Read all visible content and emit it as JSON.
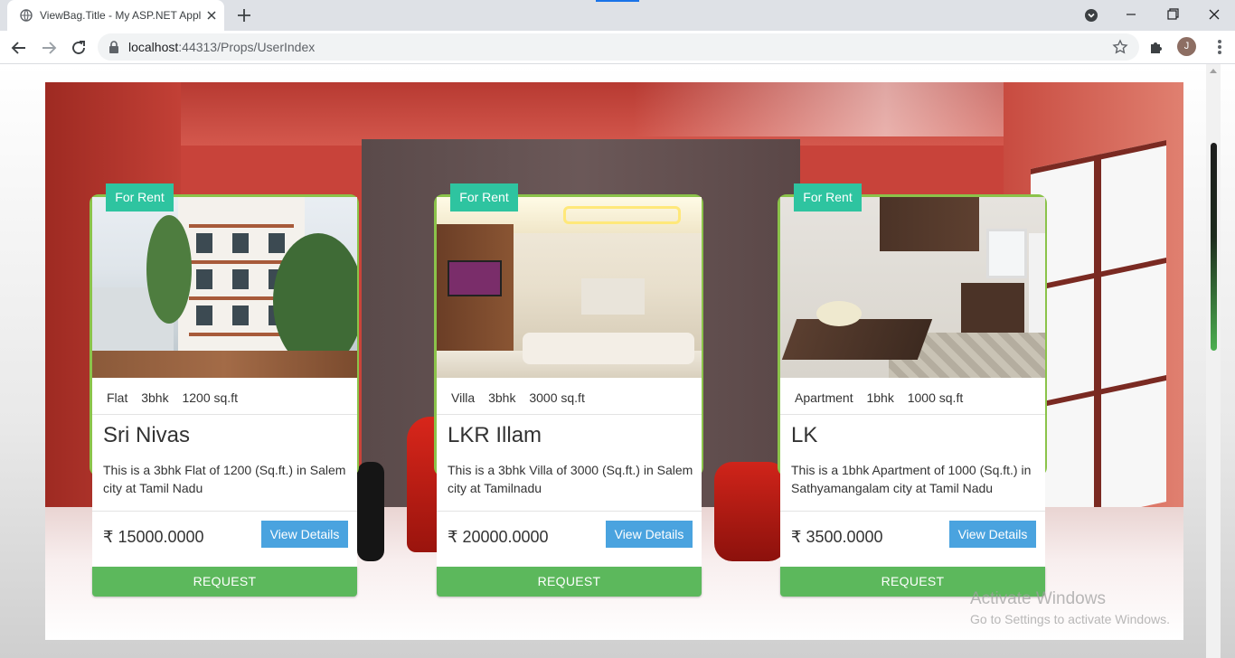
{
  "browser": {
    "tab_title": "ViewBag.Title - My ASP.NET Appl",
    "url_host": "localhost",
    "url_rest": ":44313/Props/UserIndex",
    "avatar_initial": "J"
  },
  "cards": [
    {
      "badge": "For Rent",
      "specs": [
        "Flat",
        "3bhk",
        "1200 sq.ft"
      ],
      "name": "Sri Nivas",
      "description": "This is a 3bhk Flat of 1200 (Sq.ft.) in Salem city at Tamil Nadu",
      "price": "₹ 15000.0000",
      "details_label": "View Details",
      "request_label": "REQUEST"
    },
    {
      "badge": "For Rent",
      "specs": [
        "Villa",
        "3bhk",
        "3000 sq.ft"
      ],
      "name": "LKR Illam",
      "description": "This is a 3bhk Villa of 3000 (Sq.ft.) in Salem city at Tamilnadu",
      "price": "₹ 20000.0000",
      "details_label": "View Details",
      "request_label": "REQUEST"
    },
    {
      "badge": "For Rent",
      "specs": [
        "Apartment",
        "1bhk",
        "1000 sq.ft"
      ],
      "name": "LK",
      "description": "This is a 1bhk Apartment of 1000 (Sq.ft.) in Sathyamangalam city at Tamil Nadu",
      "price": "₹ 3500.0000",
      "details_label": "View Details",
      "request_label": "REQUEST"
    }
  ],
  "watermark": {
    "line1": "Activate Windows",
    "line2": "Go to Settings to activate Windows."
  },
  "colors": {
    "badge": "#2ec4a0",
    "card_border": "#8bc34a",
    "details_button": "#4aa3df",
    "request_button": "#5cb85c"
  }
}
